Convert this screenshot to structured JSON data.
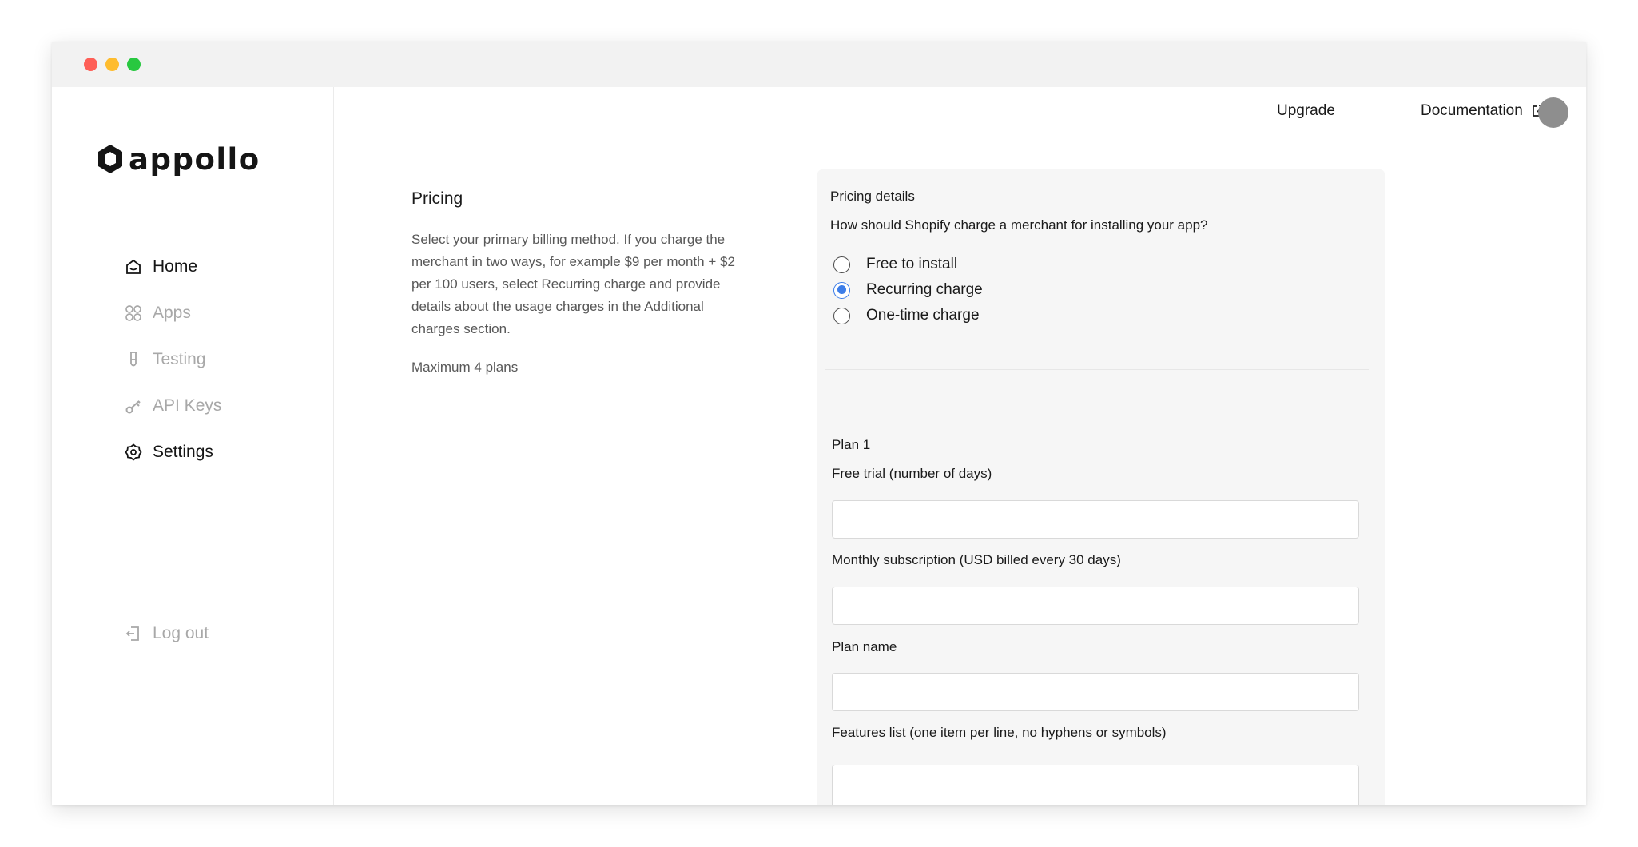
{
  "app": {
    "name": "appollo"
  },
  "sidebar": {
    "items": [
      {
        "label": "Home",
        "icon": "home-icon",
        "state": "active"
      },
      {
        "label": "Apps",
        "icon": "apps-grid-icon",
        "state": "muted"
      },
      {
        "label": "Testing",
        "icon": "test-tube-icon",
        "state": "muted"
      },
      {
        "label": "API Keys",
        "icon": "key-icon",
        "state": "muted"
      },
      {
        "label": "Settings",
        "icon": "gear-icon",
        "state": "active"
      }
    ],
    "logout": {
      "label": "Log out",
      "icon": "logout-icon"
    }
  },
  "topbar": {
    "upgrade_label": "Upgrade",
    "documentation_label": "Documentation",
    "documentation_icon": "external-link-icon"
  },
  "pricing": {
    "title": "Pricing",
    "description": "Select your primary billing method. If you charge the merchant in two ways, for example $9 per month + $2 per 100 users, select Recurring charge and provide details about the usage charges in the Additional charges section.",
    "note": "Maximum 4 plans"
  },
  "pricing_details": {
    "title": "Pricing details",
    "question": "How should Shopify charge a merchant for installing your app?",
    "options": [
      {
        "label": "Free to install",
        "checked": false
      },
      {
        "label": "Recurring charge",
        "checked": true
      },
      {
        "label": "One-time charge",
        "checked": false
      }
    ]
  },
  "plan": {
    "title": "Plan 1",
    "free_trial_label": "Free trial (number of days)",
    "free_trial_value": "",
    "monthly_label": "Monthly subscription (USD billed every 30 days)",
    "monthly_value": "",
    "name_label": "Plan name",
    "name_value": "",
    "features_label": "Features list (one item per line, no hyphens or symbols)",
    "features_value": ""
  },
  "colors": {
    "accent": "#3c7de8",
    "muted_text": "#a8a8a8",
    "card_bg": "#f6f6f6",
    "avatar": "#8e8e8e"
  }
}
